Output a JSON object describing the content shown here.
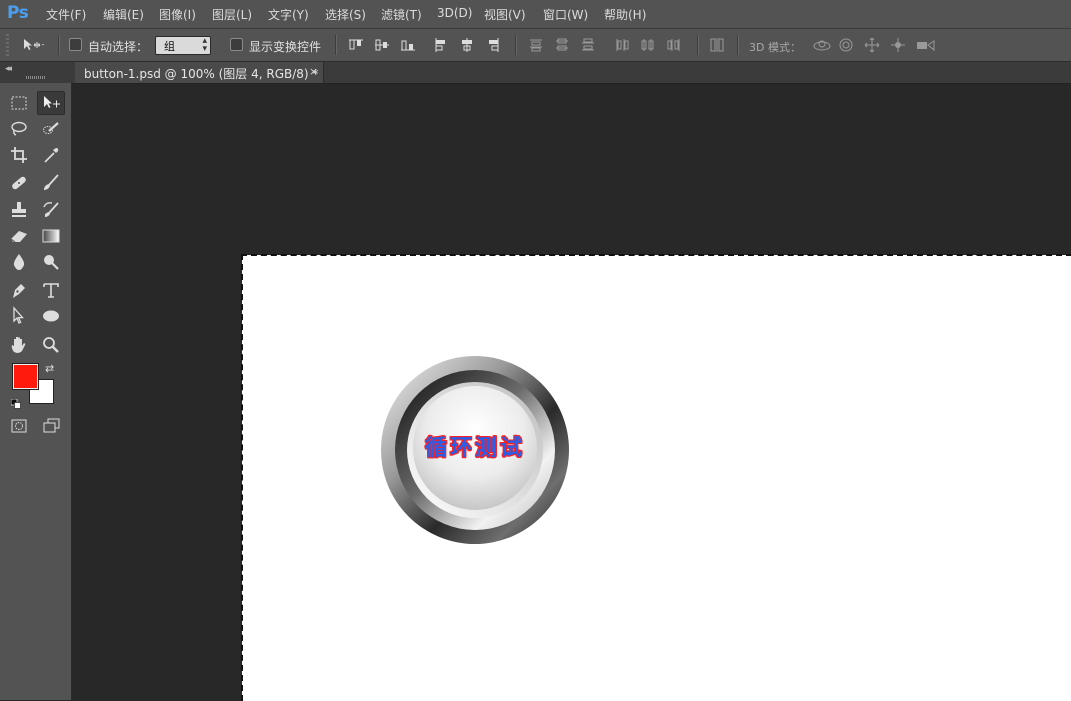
{
  "app": {
    "logo": "Ps",
    "menu": [
      "文件(F)",
      "编辑(E)",
      "图像(I)",
      "图层(L)",
      "文字(Y)",
      "选择(S)",
      "滤镜(T)",
      "3D(D)",
      "视图(V)",
      "窗口(W)",
      "帮助(H)"
    ]
  },
  "options_bar": {
    "auto_select_label": "自动选择：",
    "auto_select_checked": false,
    "auto_select_target": "组",
    "show_transform_label": "显示变换控件",
    "show_transform_checked": false,
    "mode_3d_label": "3D 模式："
  },
  "document": {
    "tab_title": "button-1.psd @ 100% (图层 4, RGB/8) *",
    "close_glyph": "×"
  },
  "colors": {
    "foreground": "#ff1a0d",
    "background": "#ffffff",
    "ui_panel": "#535353",
    "workspace": "#282828"
  },
  "canvas": {
    "button_label": "循环测试"
  }
}
